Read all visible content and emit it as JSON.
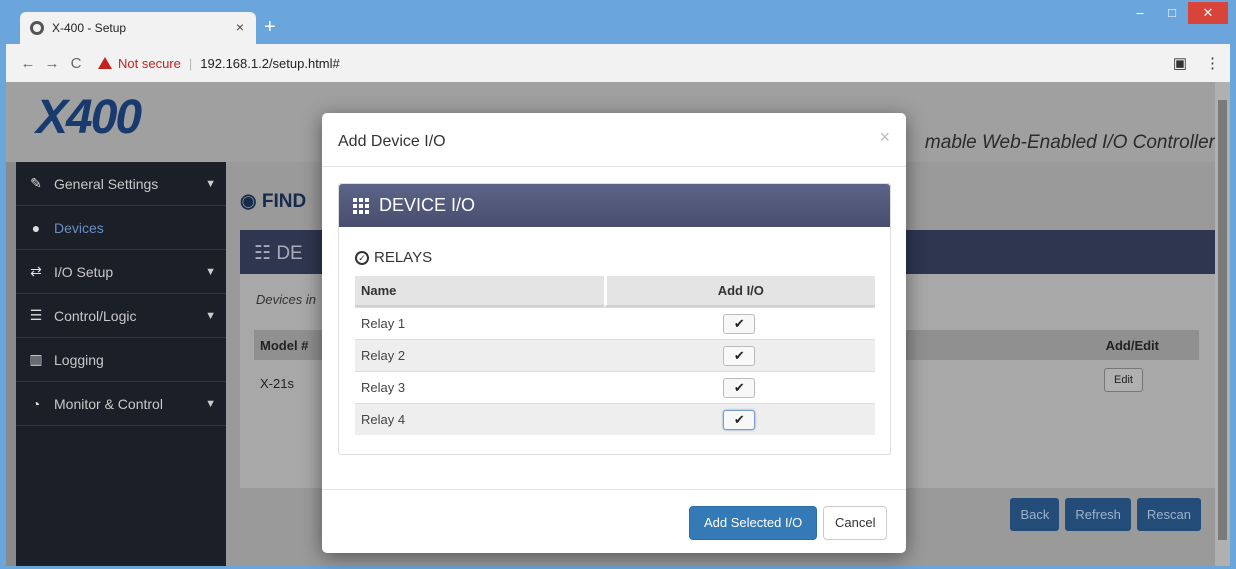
{
  "browser": {
    "tab_title": "X-400 - Setup",
    "tab_close": "×",
    "new_tab": "+",
    "not_secure": "Not secure",
    "url": "192.168.1.2/setup.html#",
    "minimize": "–",
    "maximize": "□",
    "close": "✕"
  },
  "page": {
    "logo": "X400",
    "tagline": "mable Web-Enabled I/O Controller",
    "find_title": "FIND",
    "panel_title": "DE",
    "devices_in": "Devices in",
    "table_headers": {
      "model": "Model #",
      "add_edit": "Add/Edit"
    },
    "row": {
      "model": "X-21s",
      "edit": "Edit"
    },
    "buttons": {
      "back": "Back",
      "refresh": "Refresh",
      "rescan": "Rescan"
    }
  },
  "sidebar": {
    "items": [
      {
        "label": "General Settings",
        "icon": "wrench-icon",
        "chevron": true
      },
      {
        "label": "Devices",
        "icon": "globe-icon",
        "chevron": false,
        "active": true
      },
      {
        "label": "I/O Setup",
        "icon": "exchange-icon",
        "chevron": true
      },
      {
        "label": "Control/Logic",
        "icon": "server-icon",
        "chevron": true
      },
      {
        "label": "Logging",
        "icon": "bar-chart-icon",
        "chevron": false
      },
      {
        "label": "Monitor & Control",
        "icon": "dashboard-icon",
        "chevron": true
      }
    ]
  },
  "modal": {
    "title": "Add Device I/O",
    "close": "×",
    "panel_title": "DEVICE I/O",
    "section_label": "RELAYS",
    "columns": {
      "name": "Name",
      "add": "Add I/O"
    },
    "rows": [
      {
        "name": "Relay 1",
        "checked": true
      },
      {
        "name": "Relay 2",
        "checked": true
      },
      {
        "name": "Relay 3",
        "checked": true
      },
      {
        "name": "Relay 4",
        "checked": true
      }
    ],
    "primary_button": "Add Selected I/O",
    "cancel_button": "Cancel"
  },
  "colors": {
    "primary": "#337ab7",
    "panel_header": "#4f5677",
    "sidebar": "#1a1f28"
  }
}
